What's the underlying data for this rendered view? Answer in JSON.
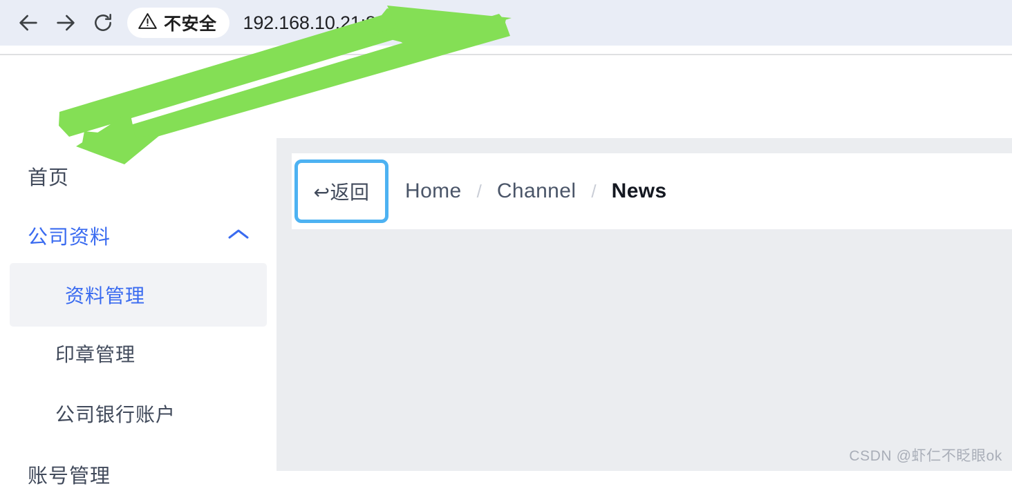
{
  "browser": {
    "back_icon": "arrow-left-icon",
    "forward_icon": "arrow-right-icon",
    "reload_icon": "reload-icon",
    "security_icon": "warning-triangle-icon",
    "security_label": "不安全",
    "url": "192.168.10.21:8686/home"
  },
  "sidebar": {
    "items": [
      {
        "label": "首页",
        "type": "item"
      },
      {
        "label": "公司资料",
        "type": "group",
        "expanded": true,
        "chevron": "chevron-up-icon"
      },
      {
        "label": "资料管理",
        "type": "subitem",
        "active": true
      },
      {
        "label": "印章管理",
        "type": "subitem",
        "active": false
      },
      {
        "label": "公司银行账户",
        "type": "subitem",
        "active": false
      },
      {
        "label": "账号管理",
        "type": "item"
      }
    ]
  },
  "content": {
    "back_button": {
      "icon": "return-arrow-icon",
      "label": "返回",
      "full_label": "↩返回"
    },
    "breadcrumb": {
      "separator": "/",
      "items": [
        {
          "label": "Home",
          "current": false
        },
        {
          "label": "Channel",
          "current": false
        },
        {
          "label": "News",
          "current": true
        }
      ]
    }
  },
  "watermark": "CSDN @虾仁不眨眼ok",
  "colors": {
    "toolbar_bg": "#e9edf6",
    "content_bg": "#ebedf0",
    "accent_blue": "#3a6bf0",
    "highlight_border": "#4db2f2",
    "annotation_green": "#84df55",
    "sidebar_active_bg": "#f2f3f6"
  }
}
